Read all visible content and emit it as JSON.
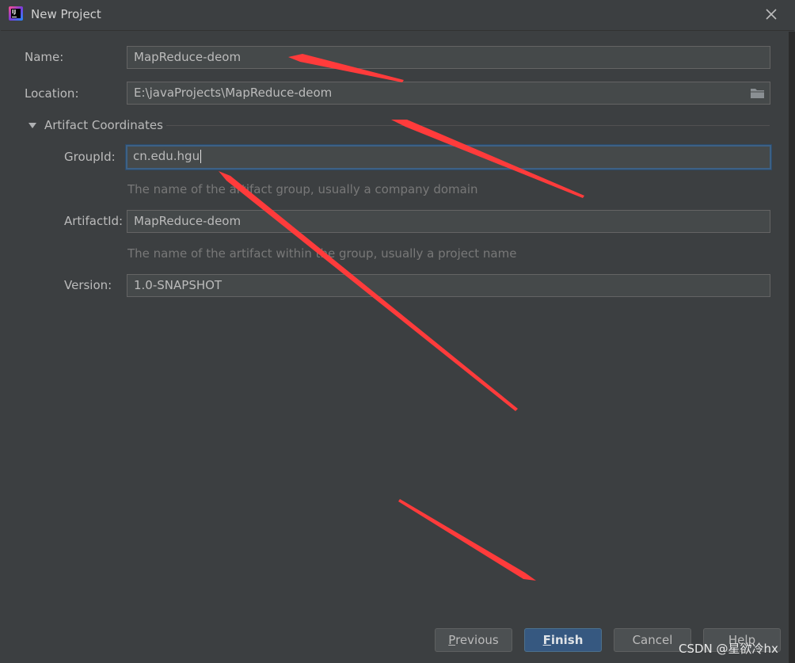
{
  "window": {
    "title": "New Project",
    "app_icon_text": "IJ"
  },
  "form": {
    "name_label": "Name:",
    "name_value": "MapReduce-deom",
    "location_label": "Location:",
    "location_value": "E:\\javaProjects\\MapReduce-deom",
    "section_title": "Artifact Coordinates",
    "groupid_label": "GroupId:",
    "groupid_value": "cn.edu.hgu",
    "groupid_hint": "The name of the artifact group, usually a company domain",
    "artifactid_label": "ArtifactId:",
    "artifactid_value": "MapReduce-deom",
    "artifactid_hint": "The name of the artifact within the group, usually a project name",
    "version_label": "Version:",
    "version_value": "1.0-SNAPSHOT"
  },
  "buttons": {
    "previous_mnemonic": "P",
    "previous_rest": "revious",
    "finish_mnemonic": "F",
    "finish_rest": "inish",
    "cancel": "Cancel",
    "help": "Help"
  },
  "watermark": "CSDN @星欲冷hx",
  "colors": {
    "accent": "#365880",
    "focus": "#3d6185",
    "annotation": "#ff3b3b",
    "background": "#3c3f41"
  }
}
